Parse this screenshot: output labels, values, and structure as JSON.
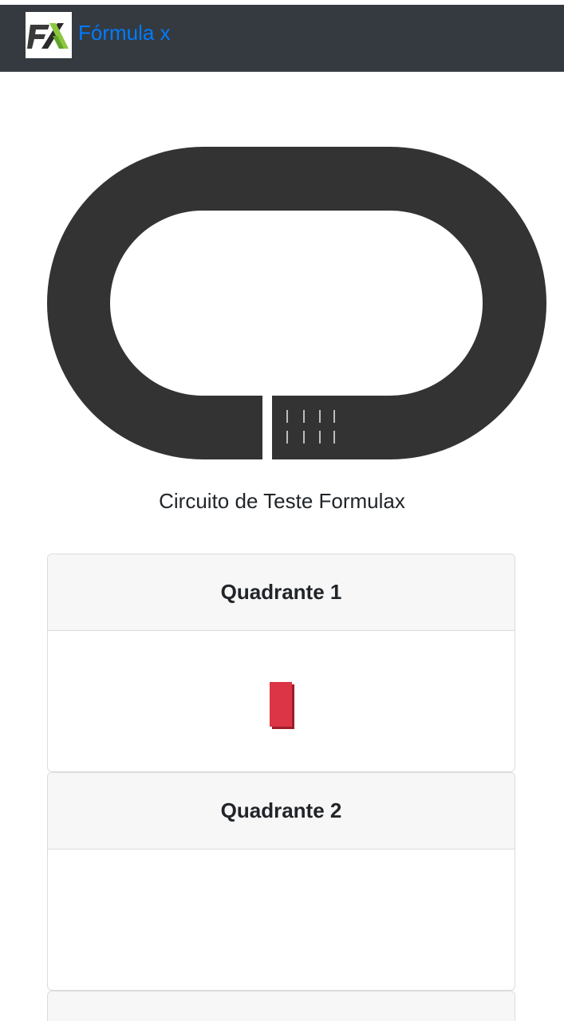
{
  "navbar": {
    "brand_text": "Fórmula x",
    "logo_icon": "fx-logo-icon",
    "background_color": "#343a40",
    "brand_color": "#007bff"
  },
  "track": {
    "caption": "Circuito de Teste Formulax",
    "track_color": "#333333",
    "marking_color": "#bdbdbd"
  },
  "quadrants": [
    {
      "title": "Quadrante 1",
      "has_car": true,
      "car_color": "#dc3545"
    },
    {
      "title": "Quadrante 2",
      "has_car": false
    },
    {
      "title": "",
      "has_car": false
    }
  ]
}
